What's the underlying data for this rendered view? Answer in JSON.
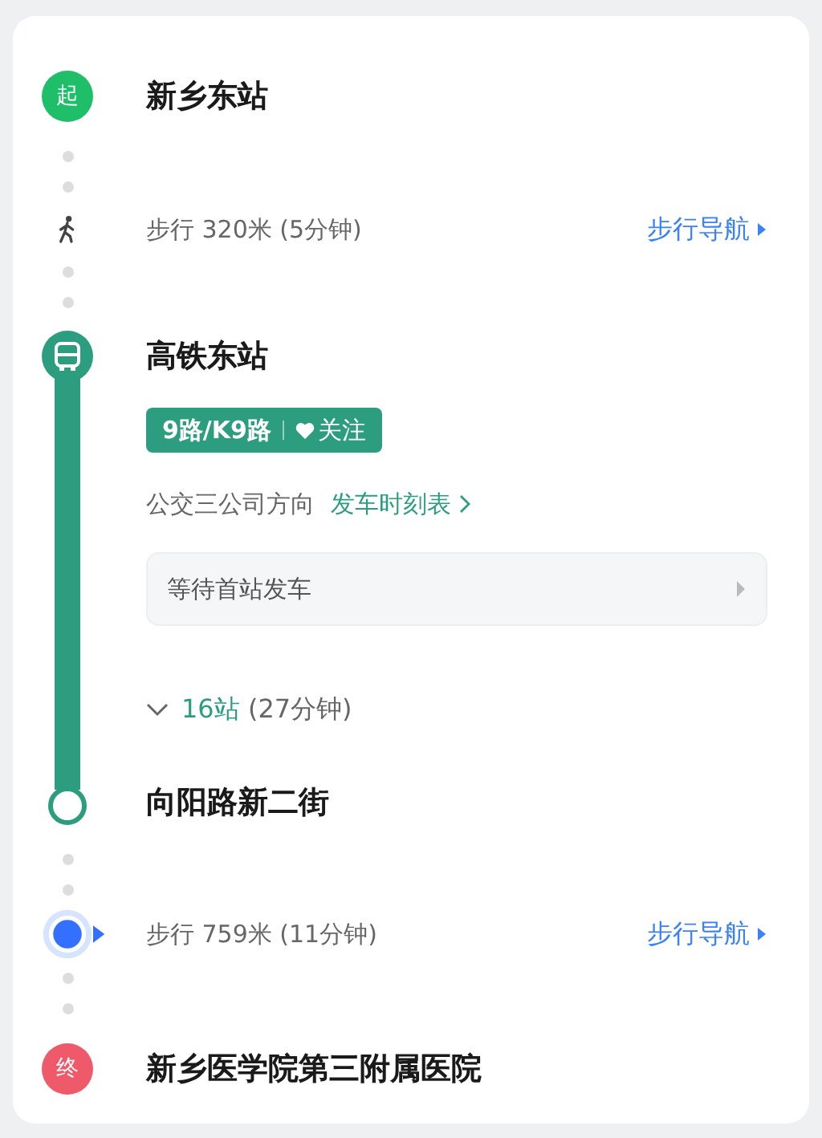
{
  "route": [
    {
      "kind": "start",
      "badge": "起",
      "name": "新乡东站"
    },
    {
      "kind": "walk",
      "current_location": false,
      "text": "步行 320米 (5分钟)",
      "nav": "步行导航"
    },
    {
      "kind": "bus",
      "station": "高铁东站",
      "line": "9路/K9路",
      "follow": "关注",
      "direction": "公交三公司方向",
      "timetable": "发车时刻表",
      "status": "等待首站发车",
      "stops": "16站",
      "duration": "(27分钟)",
      "expanded": false,
      "end_station": "向阳路新二街"
    },
    {
      "kind": "walk",
      "current_location": true,
      "text": "步行 759米 (11分钟)",
      "nav": "步行导航"
    },
    {
      "kind": "end",
      "badge": "终",
      "name": "新乡医学院第三附属医院"
    }
  ]
}
